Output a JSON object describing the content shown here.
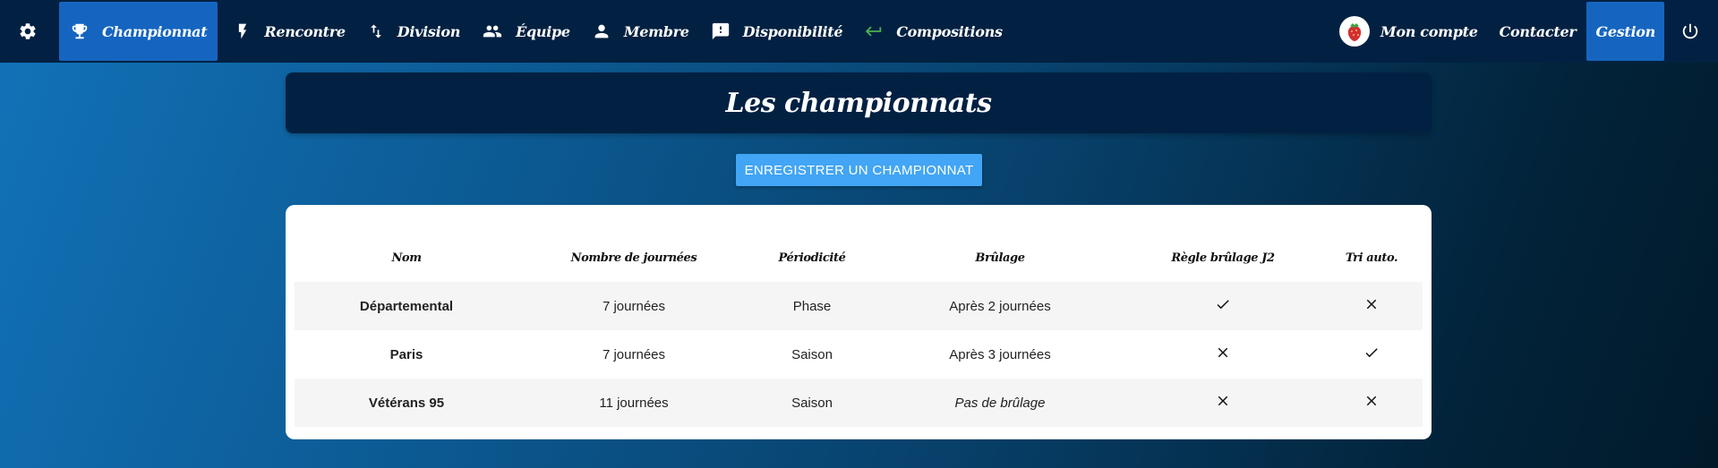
{
  "nav": {
    "items": [
      {
        "label": "Championnat",
        "icon": "trophy-icon",
        "active": true
      },
      {
        "label": "Rencontre",
        "icon": "bolt-icon"
      },
      {
        "label": "Division",
        "icon": "swap-vert-icon"
      },
      {
        "label": "Équipe",
        "icon": "group-icon"
      },
      {
        "label": "Membre",
        "icon": "person-icon"
      },
      {
        "label": "Disponibilité",
        "icon": "feedback-icon"
      },
      {
        "label": "Compositions",
        "icon": "keyboard-return-icon"
      }
    ],
    "account_label": "Mon compte",
    "contact_label": "Contacter",
    "admin_label": "Gestion"
  },
  "page": {
    "title": "Les championnats",
    "register_button": "ENREGISTRER UN CHAMPIONNAT"
  },
  "table": {
    "headers": [
      "Nom",
      "Nombre de journées",
      "Périodicité",
      "Brûlage",
      "Règle brûlage J2",
      "Tri auto."
    ],
    "rows": [
      {
        "name": "Départemental",
        "journees": "7 journées",
        "periodicite": "Phase",
        "brulage": "Après 2 journées",
        "brulage_italic": false,
        "regle_j2": true,
        "tri_auto": false
      },
      {
        "name": "Paris",
        "journees": "7 journées",
        "periodicite": "Saison",
        "brulage": "Après 3 journées",
        "brulage_italic": false,
        "regle_j2": false,
        "tri_auto": true
      },
      {
        "name": "Vétérans 95",
        "journees": "11 journées",
        "periodicite": "Saison",
        "brulage": "Pas de brûlage",
        "brulage_italic": true,
        "regle_j2": false,
        "tri_auto": false
      }
    ]
  },
  "colors": {
    "navbar": "#022142",
    "active": "#1565c0",
    "button": "#42a5f5",
    "return_icon": "#4caf50"
  }
}
